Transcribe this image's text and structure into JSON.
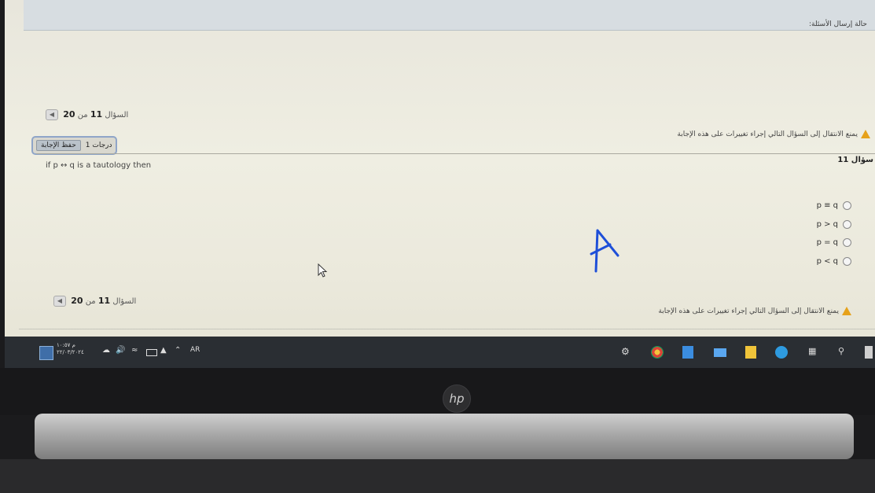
{
  "header": {
    "title": "حالة إرسال الأسئلة:"
  },
  "question_nav_top": {
    "prefix": "السؤال",
    "current": "11",
    "of": "من",
    "total": "20"
  },
  "question_nav_bottom": {
    "prefix": "السؤال",
    "current": "11",
    "of": "من",
    "total": "20"
  },
  "grade": {
    "label": "1 درجات",
    "save_label": "حفظ الإجابة"
  },
  "warning": {
    "text": "يمنع الانتقال إلى السؤال التالي إجراء تغييرات على هذه الإجابة"
  },
  "question": {
    "number_label": "سؤال 11",
    "text": "if p ↔ q is a tautology then"
  },
  "options": [
    {
      "label": "p ≡ q"
    },
    {
      "label": "p > q"
    },
    {
      "label": "p = q"
    },
    {
      "label": "p < q"
    }
  ],
  "annotation": {
    "letter": "A",
    "color": "#1e4fd8"
  },
  "taskbar": {
    "time": "م ١٠:٥٧",
    "date": "٢٢/٠٣/٢٠٢٤",
    "language": "AR"
  },
  "brand": {
    "logo": "hp"
  }
}
